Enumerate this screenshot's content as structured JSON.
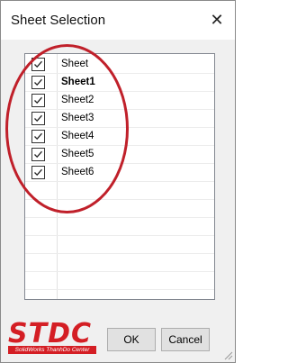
{
  "dialog": {
    "title": "Sheet Selection",
    "close_icon": "close-icon",
    "ok_label": "OK",
    "cancel_label": "Cancel"
  },
  "sheets": [
    {
      "label": "Sheet",
      "checked": true,
      "bold": false
    },
    {
      "label": "Sheet1",
      "checked": true,
      "bold": true
    },
    {
      "label": "Sheet2",
      "checked": true,
      "bold": false
    },
    {
      "label": "Sheet3",
      "checked": true,
      "bold": false
    },
    {
      "label": "Sheet4",
      "checked": true,
      "bold": false
    },
    {
      "label": "Sheet5",
      "checked": true,
      "bold": false
    },
    {
      "label": "Sheet6",
      "checked": true,
      "bold": false
    }
  ],
  "empty_row_count": 6,
  "logo": {
    "main": "STDC",
    "sub": "SolidWorks ThanhDo Center"
  },
  "colors": {
    "highlight_circle": "#c0202a",
    "logo_red": "#d41e24"
  }
}
